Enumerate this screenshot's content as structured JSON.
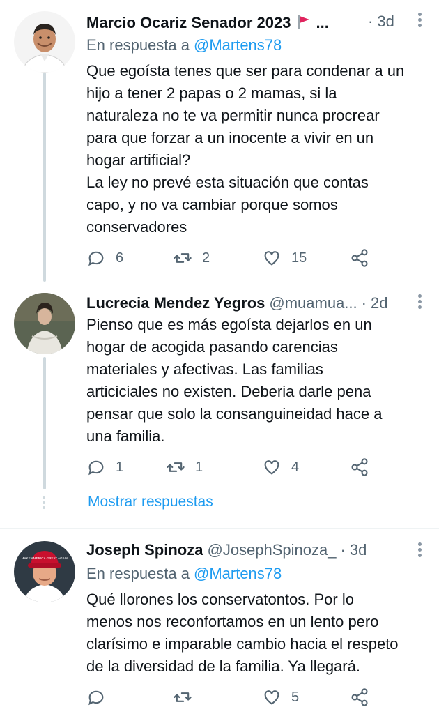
{
  "tweets": [
    {
      "author": "Marcio Ocariz Senador 2023",
      "time": "3d",
      "reply_prefix": "En respuesta a",
      "reply_to": "@Martens78",
      "lines": [
        "Que egoísta tenes que ser para condenar a un",
        "hijo a tener 2 papas o 2 mamas,  si la",
        "naturaleza no te va permitir nunca procrear",
        "para que forzar a un inocente a vivir en un",
        "hogar artificial?",
        "La ley no prevé esta situación que contas",
        "capo, y no va cambiar porque somos",
        "conservadores"
      ],
      "replies": "6",
      "retweets": "2",
      "likes": "15"
    },
    {
      "author": "Lucrecia Mendez Yegros",
      "handle": "@muamua...",
      "time": "2d",
      "lines": [
        "Pienso que es más egoísta dejarlos en un",
        "hogar de acogida pasando carencias",
        "materiales y afectivas. Las familias",
        "articiciales no existen. Deberia darle pena",
        "pensar que  solo la consanguineidad hace a",
        "una familia."
      ],
      "replies": "1",
      "retweets": "1",
      "likes": "4"
    },
    {
      "author": "Joseph Spinoza",
      "handle": "@JosephSpinoza_",
      "time": "3d",
      "reply_prefix": "En respuesta a",
      "reply_to": "@Martens78",
      "lines": [
        "Qué llorones los conservatontos. Por lo",
        "menos nos reconfortamos en un lento pero",
        "clarísimo e imparable cambio hacia el respeto",
        "de la diversidad de la familia. Ya llegará."
      ],
      "likes": "5",
      "cap_text": "MAKE AMERICA GREAT AGAIN"
    }
  ],
  "show_replies": "Mostrar respuestas",
  "ellipsis": "...",
  "separator": "·",
  "colors": {
    "text": "#0f1419",
    "secondary": "#536471",
    "accent": "#1d9bf0",
    "thread_line": "#cfd9de",
    "flag": "#e0245e"
  }
}
